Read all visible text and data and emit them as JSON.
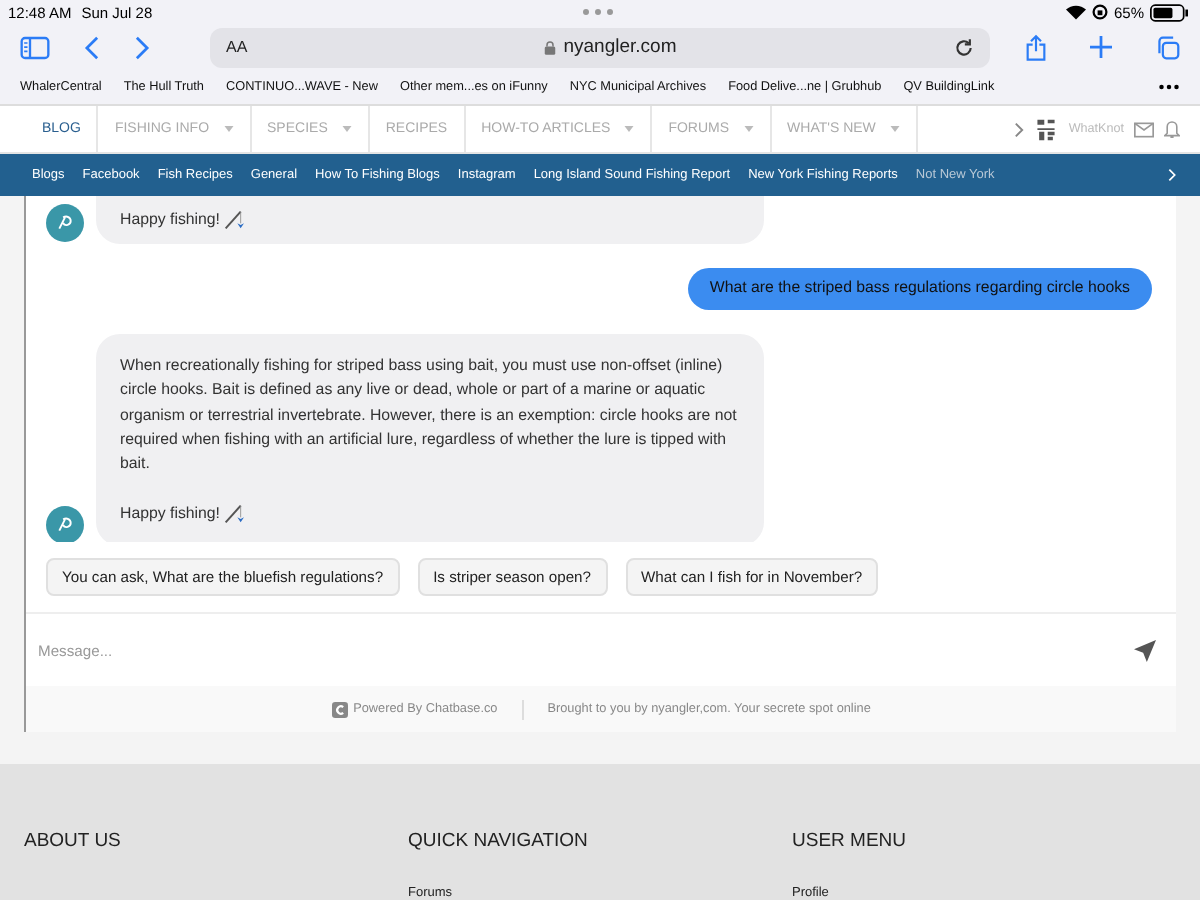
{
  "status_bar": {
    "time": "12:48 AM",
    "date": "Sun Jul 28",
    "battery": "65%"
  },
  "browser": {
    "text_size_button": "AA",
    "url": "nyangler.com"
  },
  "bookmarks": [
    "WhalerCentral",
    "The Hull Truth",
    "CONTINUO...WAVE - New",
    "Other mem...es on iFunny",
    "NYC Municipal Archives",
    "Food Delive...ne | Grubhub",
    "QV BuildingLink"
  ],
  "nav": {
    "items": [
      {
        "label": "BLOG",
        "selected": true,
        "dropdown": false
      },
      {
        "label": "FISHING INFO",
        "selected": false,
        "dropdown": true
      },
      {
        "label": "SPECIES",
        "selected": false,
        "dropdown": true
      },
      {
        "label": "RECIPES",
        "selected": false,
        "dropdown": false
      },
      {
        "label": "HOW-TO ARTICLES",
        "selected": false,
        "dropdown": true
      },
      {
        "label": "FORUMS",
        "selected": false,
        "dropdown": true
      },
      {
        "label": "WHAT'S NEW",
        "selected": false,
        "dropdown": true
      }
    ],
    "user": "WhatKnot"
  },
  "subnav": [
    "Blogs",
    "Facebook",
    "Fish Recipes",
    "General",
    "How To Fishing Blogs",
    "Instagram",
    "Long Island Sound Fishing Report",
    "New York Fishing Reports",
    "Not New York"
  ],
  "chat": {
    "messages": [
      {
        "kind": "bot",
        "paragraphs": [
          {
            "kind": "signoff",
            "text": "Happy fishing!"
          }
        ]
      },
      {
        "kind": "user",
        "paragraphs": [
          {
            "kind": "text",
            "text": "What are the striped bass regulations regarding circle hooks"
          }
        ]
      },
      {
        "kind": "bot",
        "paragraphs": [
          {
            "kind": "text",
            "text": "When recreationally fishing for striped bass using bait, you must use non-offset (inline) circle hooks. Bait is defined as any live or dead, whole or part of a marine or aquatic organism or terrestrial invertebrate. However, there is an exemption: circle hooks are not required when fishing with an artificial lure, regardless of whether the lure is tipped with bait."
          },
          {
            "kind": "signoff",
            "text": "Happy fishing!"
          }
        ]
      }
    ],
    "suggestions": [
      "You can ask, What are the bluefish regulations?",
      "Is striper season open?",
      "What can I fish for in November?"
    ],
    "input": {
      "placeholder": "Message..."
    },
    "powered_by": "Powered By Chatbase.co",
    "credit": "Brought to you by nyangler,com. Your secrete spot online"
  },
  "footer": [
    {
      "heading": "ABOUT US"
    },
    {
      "heading": "QUICK NAVIGATION",
      "links": [
        "Forums"
      ]
    },
    {
      "heading": "USER MENU",
      "links": [
        "Profile"
      ]
    }
  ]
}
